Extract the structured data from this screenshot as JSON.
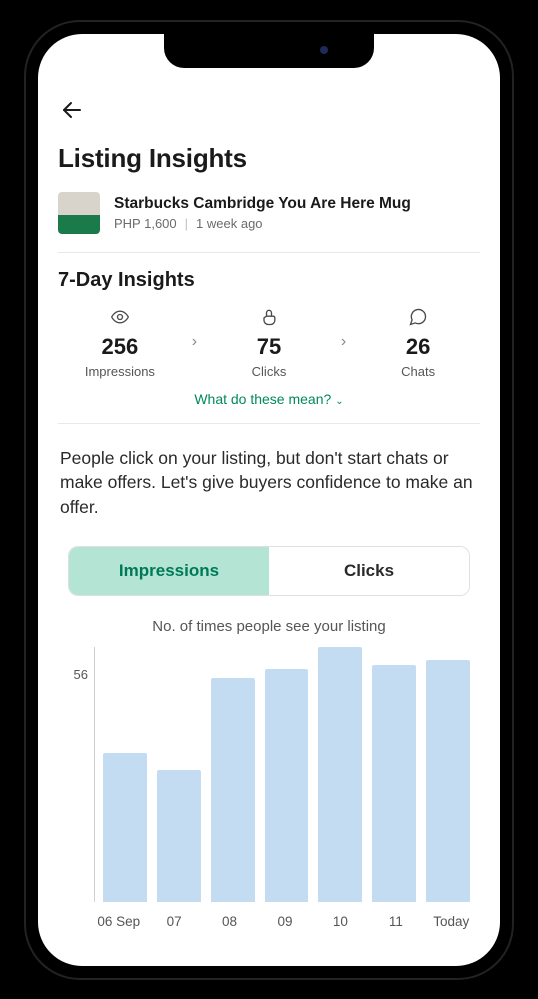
{
  "page_title": "Listing Insights",
  "listing": {
    "title": "Starbucks Cambridge You Are Here Mug",
    "price": "PHP 1,600",
    "age": "1 week ago"
  },
  "section_title": "7-Day Insights",
  "stats": {
    "impressions": {
      "value": "256",
      "label": "Impressions"
    },
    "clicks": {
      "value": "75",
      "label": "Clicks"
    },
    "chats": {
      "value": "26",
      "label": "Chats"
    }
  },
  "help_link": "What do these mean?",
  "insight_text": "People click on your listing, but don't start chats or make offers. Let's give buyers confidence to make an offer.",
  "tabs": {
    "impressions": "Impressions",
    "clicks": "Clicks"
  },
  "chart_caption": "No. of times people see your listing",
  "chart_data": {
    "type": "bar",
    "title": "No. of times people see your listing",
    "xlabel": "",
    "ylabel": "",
    "y_ref_tick": 56,
    "categories": [
      "06 Sep",
      "07",
      "08",
      "09",
      "10",
      "11",
      "Today"
    ],
    "values": [
      34,
      30,
      51,
      53,
      58,
      54,
      55
    ]
  },
  "colors": {
    "accent": "#008860",
    "accent_bg": "#b3e4d4",
    "bar": "#c4dcf2"
  }
}
